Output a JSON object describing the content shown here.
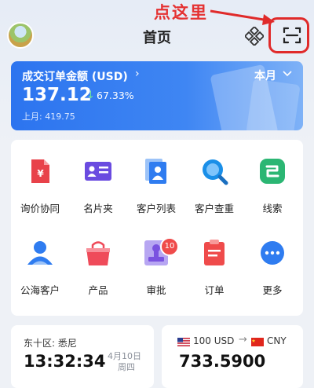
{
  "annotation": {
    "text": "点这里"
  },
  "header": {
    "title": "首页"
  },
  "stats": {
    "label": "成交订单金额 (USD)",
    "period": "本月",
    "amount": "137.12",
    "change": "67.33%",
    "last_month": "上月: 419.75"
  },
  "functions": [
    {
      "label": "询价协同",
      "icon": "quote-doc-icon",
      "color": "#e8424a"
    },
    {
      "label": "名片夹",
      "icon": "business-card-icon",
      "color": "#6a4be0"
    },
    {
      "label": "客户列表",
      "icon": "customer-list-icon",
      "color": "#2f7cf0"
    },
    {
      "label": "客户查重",
      "icon": "customer-search-icon",
      "color": "#1a8fe8"
    },
    {
      "label": "线索",
      "icon": "clue-icon",
      "color": "#2bb673"
    },
    {
      "label": "公海客户",
      "icon": "public-customer-icon",
      "color": "#2f7cf0"
    },
    {
      "label": "产品",
      "icon": "product-bag-icon",
      "color": "#ef4b5a"
    },
    {
      "label": "审批",
      "icon": "approval-stamp-icon",
      "color": "#7a52e0"
    },
    {
      "label": "订单",
      "icon": "order-clipboard-icon",
      "color": "#ef4b4b"
    },
    {
      "label": "更多",
      "icon": "more-icon",
      "color": "#2f7cf0"
    }
  ],
  "approval_badge": "10",
  "timezone": {
    "label": "东十区: 悉尼",
    "time": "13:32:34",
    "date": "4月10日",
    "weekday": "周四"
  },
  "exchange": {
    "from": "100 USD",
    "to": "CNY",
    "rate": "733.5900"
  }
}
